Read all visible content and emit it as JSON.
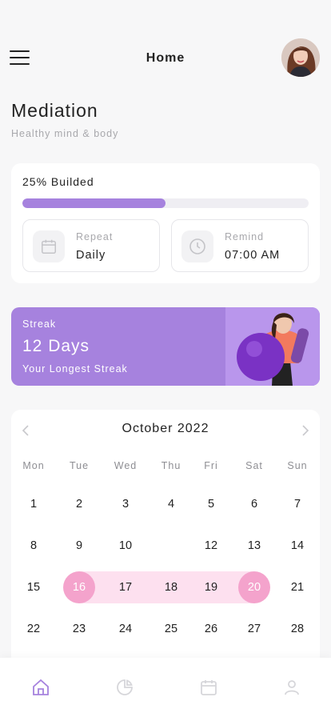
{
  "header": {
    "title": "Home",
    "menu_icon": "menu-icon",
    "avatar": "user-avatar"
  },
  "page": {
    "title": "Mediation",
    "subtitle": "Healthy mind & body"
  },
  "progress": {
    "label": "25% Builded",
    "fraction": 0.5,
    "accent": "#a682de",
    "repeat": {
      "label": "Repeat",
      "value": "Daily",
      "icon": "calendar-icon"
    },
    "remind": {
      "label": "Remind",
      "value": "07:00 AM",
      "icon": "clock-icon"
    }
  },
  "streak": {
    "label": "Streak",
    "value": "12 Days",
    "subtitle": "Your Longest Streak",
    "color": "#a682de"
  },
  "calendar": {
    "month": "October 2022",
    "weekdays": [
      "Mon",
      "Tue",
      "Wed",
      "Thu",
      "Fri",
      "Sat",
      "Sun"
    ],
    "weeks": [
      [
        "1",
        "2",
        "3",
        "4",
        "5",
        "6",
        "7"
      ],
      [
        "8",
        "9",
        "10",
        "",
        "12",
        "13",
        "14"
      ],
      [
        "15",
        "16",
        "17",
        "18",
        "19",
        "20",
        "21"
      ],
      [
        "22",
        "23",
        "24",
        "25",
        "26",
        "27",
        "28"
      ]
    ],
    "selected_range": {
      "start": "16",
      "end": "20"
    },
    "range_color": "#fde0ef",
    "edge_color": "#f4a3cc"
  },
  "nav": {
    "items": [
      {
        "icon": "home-icon",
        "active": true
      },
      {
        "icon": "pie-chart-icon",
        "active": false
      },
      {
        "icon": "calendar-icon",
        "active": false
      },
      {
        "icon": "profile-icon",
        "active": false
      }
    ],
    "active_color": "#a682de",
    "inactive_color": "#d6d6da"
  }
}
